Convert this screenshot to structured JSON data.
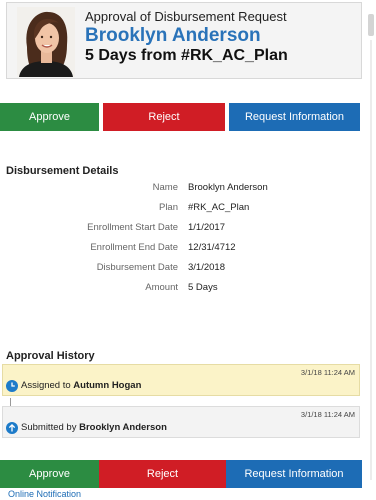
{
  "header": {
    "request_title": "Approval of Disbursement Request",
    "requester_name": "Brooklyn Anderson",
    "subtitle": "5 Days from #RK_AC_Plan"
  },
  "actions": {
    "approve": "Approve",
    "reject": "Reject",
    "request_info": "Request Information"
  },
  "details": {
    "section_title": "Disbursement Details",
    "rows": [
      {
        "label": "Name",
        "value": "Brooklyn Anderson"
      },
      {
        "label": "Plan",
        "value": "#RK_AC_Plan"
      },
      {
        "label": "Enrollment Start Date",
        "value": "1/1/2017"
      },
      {
        "label": "Enrollment End Date",
        "value": "12/31/4712"
      },
      {
        "label": "Disbursement Date",
        "value": "3/1/2018"
      },
      {
        "label": "Amount",
        "value": "5 Days"
      }
    ]
  },
  "history": {
    "section_title": "Approval History",
    "items": [
      {
        "time": "3/1/18 11:24 AM",
        "prefix": "Assigned to",
        "person": "Autumn Hogan",
        "icon": "clock-icon",
        "color": "#1d7bc9"
      },
      {
        "time": "3/1/18 11:24 AM",
        "prefix": "Submitted by",
        "person": "Brooklyn Anderson",
        "icon": "arrow-up-icon",
        "color": "#1d7bc9"
      }
    ]
  },
  "footer": {
    "link": "Online Notification"
  },
  "colors": {
    "approve": "#2c8c42",
    "reject": "#d01d25",
    "info": "#1d6cb5",
    "name_blue": "#2a73b9"
  }
}
